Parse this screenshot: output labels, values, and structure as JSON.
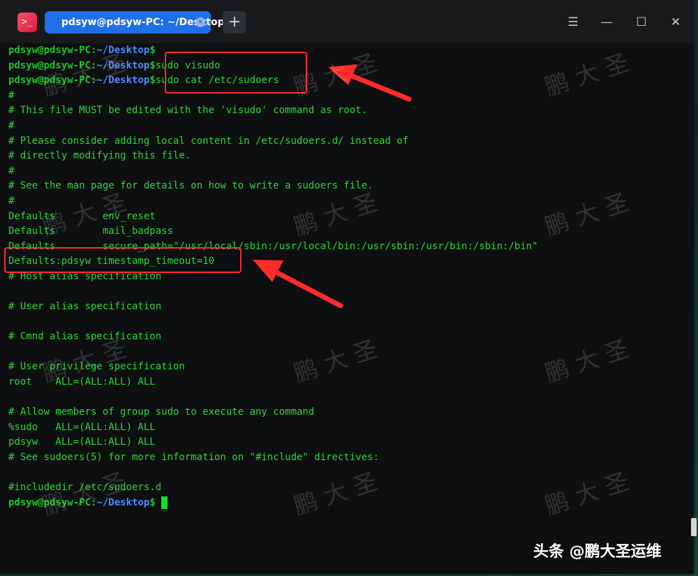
{
  "window": {
    "tab_title": "pdsyw@pdsyw-PC: ~/Desktop",
    "new_tab_label": "+",
    "tab_close_glyph": "×",
    "app_icon_glyph": ">_",
    "menu_glyph": "☰",
    "minimize_glyph": "—",
    "maximize_glyph": "☐",
    "close_glyph": "✕"
  },
  "prompt": {
    "user": "pdsyw@pdsyw-PC",
    "sep": ":",
    "path": "~/Desktop",
    "symbol": "$"
  },
  "commands": [
    "",
    "sudo visudo",
    "sudo cat /etc/sudoers"
  ],
  "output": [
    "#",
    "# This file MUST be edited with the 'visudo' command as root.",
    "#",
    "# Please consider adding local content in /etc/sudoers.d/ instead of",
    "# directly modifying this file.",
    "#",
    "# See the man page for details on how to write a sudoers file.",
    "#",
    "Defaults        env_reset",
    "Defaults        mail_badpass",
    "Defaults        secure_path=\"/usr/local/sbin:/usr/local/bin:/usr/sbin:/usr/bin:/sbin:/bin\"",
    "Defaults:pdsyw timestamp_timeout=10",
    "# Host alias specification",
    "",
    "# User alias specification",
    "",
    "# Cmnd alias specification",
    "",
    "# User privilege specification",
    "root    ALL=(ALL:ALL) ALL",
    "",
    "# Allow members of group sudo to execute any command",
    "%sudo   ALL=(ALL:ALL) ALL",
    "pdsyw   ALL=(ALL:ALL) ALL",
    "# See sudoers(5) for more information on \"#include\" directives:",
    "",
    "#includedir /etc/sudoers.d"
  ],
  "watermark_text": "鹏 大 圣",
  "credit": "头条 @鹏大圣运维",
  "colors": {
    "terminal_text": "#2fd63a",
    "prompt_path": "#4f8cff",
    "annotation": "#ff2b2b",
    "tab_active": "#1f6fe6"
  }
}
